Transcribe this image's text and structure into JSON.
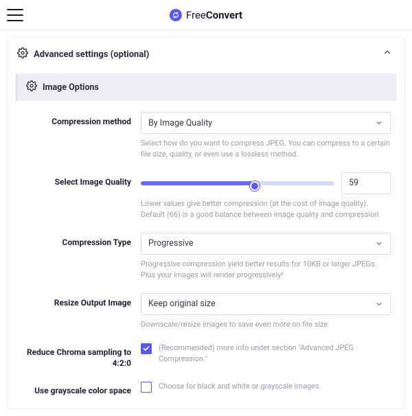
{
  "brand": {
    "name_light": "Free",
    "name_bold": "Convert"
  },
  "section": {
    "title": "Advanced settings (optional)"
  },
  "subheader": {
    "title": "Image Options"
  },
  "fields": {
    "compression_method": {
      "label": "Compression method",
      "value": "By Image Quality",
      "hint": "Select how do you want to compress JPEG. You can compress to a certain file size, quality, or even use a lossless method."
    },
    "image_quality": {
      "label": "Select Image Quality",
      "value": "59",
      "hint": "Lower values give better compression (at the cost of image quality). Default (66) is a good balance between image quality and compression"
    },
    "compression_type": {
      "label": "Compression Type",
      "value": "Progressive",
      "hint": "Progressive compression yield better results for 10KB or larger JPEGs. Plus your images will render progressively!"
    },
    "resize_output": {
      "label": "Resize Output Image",
      "value": "Keep original size",
      "hint": "Downscale/resize images to save even more on file size"
    },
    "reduce_chroma": {
      "label": "Reduce Chroma sampling to 4:2:0",
      "hint": "(Recommended) more info under section \"Advanced JPEG Compression.\""
    },
    "grayscale": {
      "label": "Use grayscale color space",
      "hint": "Choose for black and white or grayscale images."
    }
  }
}
